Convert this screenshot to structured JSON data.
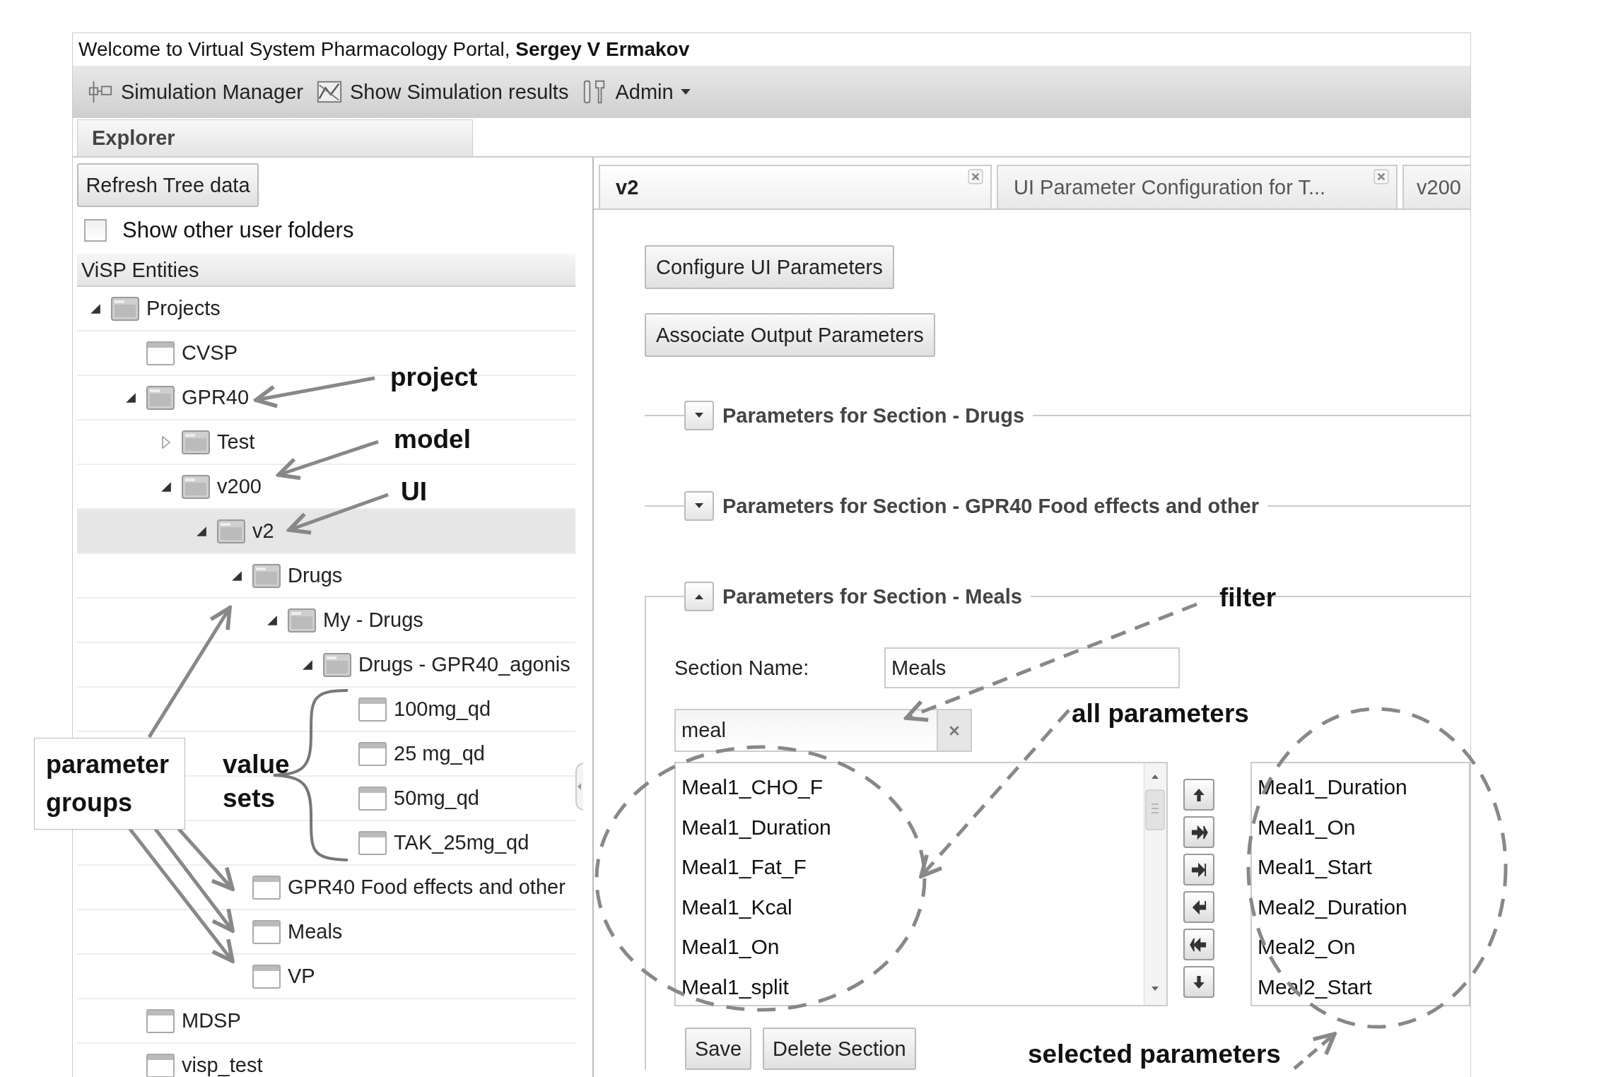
{
  "header": {
    "welcome": "Welcome to Virtual System Pharmacology Portal, **Sergey V Ermakov**"
  },
  "toolbar": [
    {
      "label": "Simulation Manager",
      "kind": "simulation",
      "dropdown": false
    },
    {
      "label": "Show Simulation results",
      "kind": "results",
      "dropdown": false
    },
    {
      "label": "Admin",
      "kind": "admin",
      "dropdown": true
    }
  ],
  "explorer_tab": {
    "label": "Explorer",
    "selected": true
  },
  "sidebar": {
    "refresh_button": "Refresh Tree data",
    "show_other": {
      "label": "Show other user folders",
      "checked": false
    },
    "tree_header": "ViSP Entities",
    "tree": [
      {
        "label": "Projects",
        "kind": "folder",
        "expanded": true,
        "selected": false,
        "children": [
          {
            "label": "CVSP",
            "kind": "item",
            "selected": false
          },
          {
            "label": "GPR40",
            "kind": "folder",
            "expanded": true,
            "selected": false,
            "children": [
              {
                "label": "Test",
                "kind": "folder",
                "expanded": false,
                "selected": false
              },
              {
                "label": "v200",
                "kind": "folder",
                "expanded": true,
                "selected": false,
                "children": [
                  {
                    "label": "v2",
                    "kind": "folder",
                    "expanded": true,
                    "selected": true,
                    "children": [
                      {
                        "label": "Drugs",
                        "kind": "folder",
                        "expanded": true,
                        "selected": false,
                        "children": [
                          {
                            "label": "My - Drugs",
                            "kind": "folder",
                            "expanded": true,
                            "selected": false,
                            "children": [
                              {
                                "label": "Drugs - GPR40_agonis",
                                "kind": "folder",
                                "expanded": true,
                                "selected": false,
                                "children": [
                                  {
                                    "label": "100mg_qd",
                                    "kind": "item",
                                    "selected": false
                                  },
                                  {
                                    "label": "25 mg_qd",
                                    "kind": "item",
                                    "selected": false
                                  },
                                  {
                                    "label": "50mg_qd",
                                    "kind": "item",
                                    "selected": false
                                  },
                                  {
                                    "label": "TAK_25mg_qd",
                                    "kind": "item",
                                    "selected": false
                                  }
                                ]
                              }
                            ]
                          }
                        ]
                      },
                      {
                        "label": "GPR40 Food effects and other",
                        "kind": "item",
                        "selected": false
                      },
                      {
                        "label": "Meals",
                        "kind": "item",
                        "selected": false
                      },
                      {
                        "label": "VP",
                        "kind": "item",
                        "selected": false
                      }
                    ]
                  }
                ]
              }
            ]
          },
          {
            "label": "MDSP",
            "kind": "item",
            "selected": false
          },
          {
            "label": "visp_test",
            "kind": "item",
            "selected": false
          }
        ]
      }
    ]
  },
  "tabs": [
    {
      "label": "v2",
      "selected": true,
      "closable": true
    },
    {
      "label": "UI Parameter Configuration for T...",
      "selected": false,
      "closable": true
    },
    {
      "label": "v200",
      "selected": false,
      "closable": false
    }
  ],
  "buttons": [
    "Configure UI Parameters",
    "Associate Output Parameters"
  ],
  "sections": [
    {
      "title": "Parameters for Section - Drugs",
      "expanded": false
    },
    {
      "title": "Parameters for Section - GPR40 Food effects and other",
      "expanded": false
    },
    {
      "title": "Parameters for Section - Meals",
      "expanded": true,
      "editor": {
        "section_name_label": "Section Name:",
        "section_name": "Meals",
        "filter": "meal",
        "all_parameters": [
          "Meal1_CHO_F",
          "Meal1_Duration",
          "Meal1_Fat_F",
          "Meal1_Kcal",
          "Meal1_On",
          "Meal1_split"
        ],
        "selected_parameters": [
          "Meal1_Duration",
          "Meal1_On",
          "Meal1_Start",
          "Meal2_Duration",
          "Meal2_On",
          "Meal2_Start"
        ],
        "buttons": [
          "Save",
          "Delete Section"
        ]
      }
    }
  ],
  "annotations": [
    {
      "text": "project",
      "kind": "plain"
    },
    {
      "text": "model",
      "kind": "plain"
    },
    {
      "text": "UI",
      "kind": "plain"
    },
    {
      "text": "filter",
      "kind": "plain"
    },
    {
      "text": "all parameters",
      "kind": "plain"
    },
    {
      "text": "parameter groups",
      "kind": "boxed"
    },
    {
      "text": "value sets",
      "kind": "plain"
    },
    {
      "text": "selected parameters",
      "kind": "plain"
    }
  ]
}
